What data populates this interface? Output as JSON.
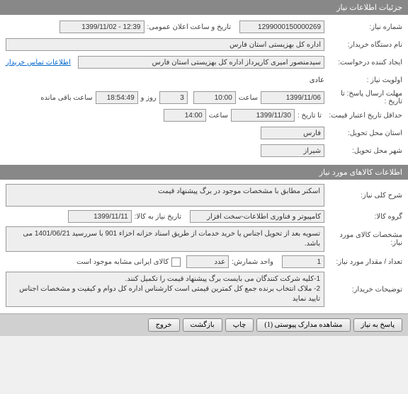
{
  "sections": {
    "need_info_header": "جزئیات اطلاعات نیاز",
    "goods_info_header": "اطلاعات کالاهای مورد نیاز"
  },
  "need": {
    "number_label": "شماره نیاز:",
    "number_value": "1299000150000269",
    "pub_datetime_label": "تاریخ و ساعت اعلان عمومی:",
    "pub_datetime_value": "12:39 - 1399/11/02",
    "buyer_org_label": "نام دستگاه خریدار:",
    "buyer_org_value": "اداره کل بهزیستی استان فارس",
    "requester_label": "ایجاد کننده درخواست:",
    "requester_value": "سیدمنصور امیری کارپرداز اداره کل بهزیستی استان فارس",
    "contact_link": "اطلاعات تماس خریدار",
    "priority_label": "اولویت نیاز :",
    "priority_value": "عادی",
    "response_deadline_label": "مهلت ارسال پاسخ:",
    "to_date_label": "تا تاریخ :",
    "response_date": "1399/11/06",
    "time_label": "ساعت",
    "response_time": "10:00",
    "remain_days": "3",
    "days_and_label": "روز و",
    "remain_time": "18:54:49",
    "remain_suffix": "ساعت باقی مانده",
    "min_credit_label": "حداقل تاریخ اعتبار قیمت:",
    "credit_date": "1399/11/30",
    "credit_time": "14:00",
    "deliver_province_label": "استان محل تحویل:",
    "deliver_province": "فارس",
    "deliver_city_label": "شهر محل تحویل:",
    "deliver_city": "شیراز"
  },
  "goods": {
    "general_desc_label": "شرح کلی نیاز:",
    "general_desc_value": "اسکنر مطابق با مشخصات موجود در برگ پیشنهاد قیمت",
    "group_label": "گروه کالا:",
    "group_value": "کامپیوتر و فناوری اطلاعات-سخت افزار",
    "need_to_date_label": "تاریخ نیاز به کالا:",
    "need_to_date_value": "1399/11/11",
    "spec_label": "مشخصات کالای مورد نیاز:",
    "spec_value": "تسویه بعد از تحویل اجناس یا خرید خدمات  از طریق اسناد خزانه اخزاء 901 با سررسید  1401/06/21 می باشد.",
    "qty_label": "تعداد / مقدار مورد نیاز:",
    "qty_value": "1",
    "unit_label": "واحد شمارش:",
    "unit_value": "عدد",
    "iran_goods_label": "کالای ایرانی مشابه موجود است",
    "buyer_notes_label": "توضیحات خریدار:",
    "buyer_notes_value": "1-کلیه شرکت کنندگان می بایست برگ پیشنهاد قیمت را تکمیل کنند.\n2-  ملاک انتخاب برنده جمع کل کمترین قیمتی است کارشناس اداره کل  دوام و کیفیت و مشخصات اجناس تایید نماید"
  },
  "buttons": {
    "reply": "پاسخ به نیاز",
    "attachments": "مشاهده مدارک پیوستی (1)",
    "print": "چاپ",
    "back": "بازگشت",
    "exit": "خروج"
  }
}
